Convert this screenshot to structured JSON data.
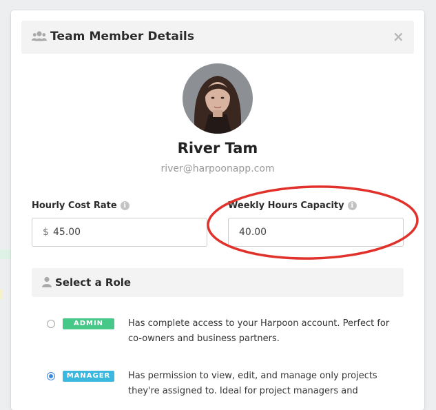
{
  "modal": {
    "title": "Team Member Details",
    "close_glyph": "×",
    "header_icon": "users-icon",
    "close_icon": "close-icon"
  },
  "member": {
    "name": "River Tam",
    "email": "river@harpoonapp.com"
  },
  "fields": {
    "hourly_cost_rate": {
      "label": "Hourly Cost Rate",
      "currency_symbol": "$",
      "value": "45.00",
      "info_glyph": "i"
    },
    "weekly_hours_capacity": {
      "label": "Weekly Hours Capacity",
      "value": "40.00",
      "info_glyph": "i"
    }
  },
  "roles": {
    "title": "Select a Role",
    "items": [
      {
        "badge": "ADMIN",
        "badge_color": "#48c888",
        "description": "Has complete access to your Harpoon account. Perfect for co-owners and business partners.",
        "selected": false
      },
      {
        "badge": "MANAGER",
        "badge_color": "#3cb7de",
        "description": "Has permission to view, edit, and manage only projects they're assigned to. Ideal for project managers and",
        "selected": true
      }
    ]
  },
  "colors": {
    "accent_blue": "#3c88dc",
    "annotation_red": "#e0312b"
  }
}
